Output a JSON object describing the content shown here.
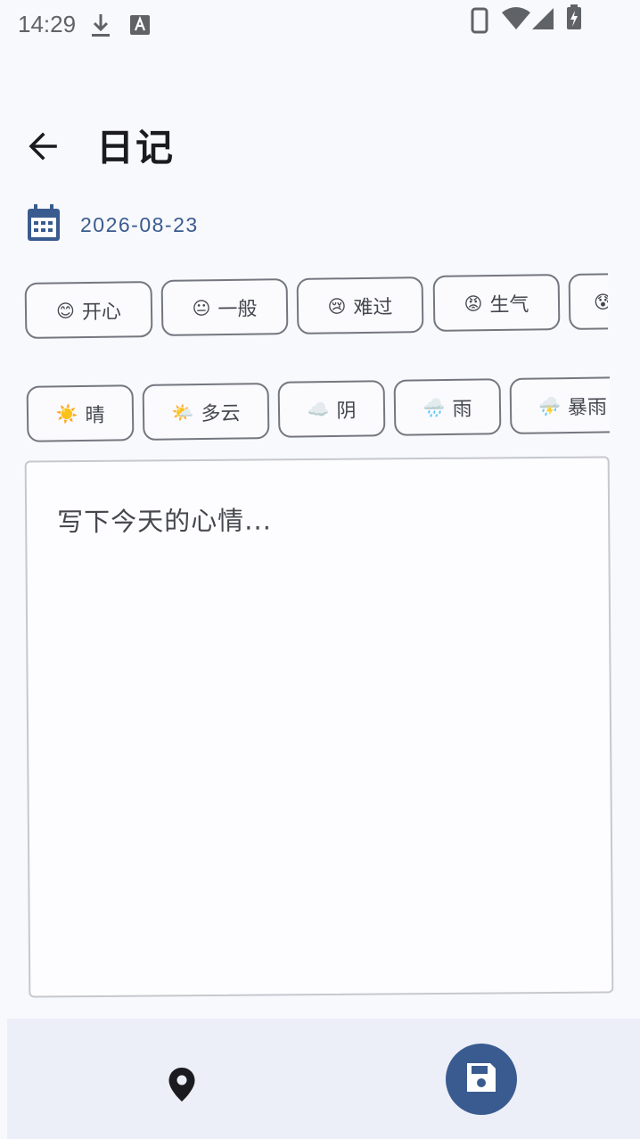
{
  "status_bar": {
    "time": "14:29",
    "icons": [
      "download-icon",
      "text-a-icon",
      "phone-icon",
      "wifi-icon",
      "signal-icon",
      "battery-charging-icon"
    ]
  },
  "app_bar": {
    "title": "日记",
    "back_icon": "arrow-left-icon"
  },
  "date_row": {
    "icon": "calendar-icon",
    "date": "2026-08-23"
  },
  "moods": [
    {
      "emoji": "😊",
      "label": "开心"
    },
    {
      "emoji": "😐",
      "label": "一般"
    },
    {
      "emoji": "😢",
      "label": "难过"
    },
    {
      "emoji": "😡",
      "label": "生气"
    },
    {
      "emoji": "😰",
      "label": ""
    }
  ],
  "weather": [
    {
      "emoji": "☀️",
      "label": "晴"
    },
    {
      "emoji": "🌤️",
      "label": "多云"
    },
    {
      "emoji": "☁️",
      "label": "阴"
    },
    {
      "emoji": "🌧️",
      "label": "雨"
    },
    {
      "emoji": "⛈️",
      "label": "暴雨"
    }
  ],
  "editor": {
    "placeholder": "写下今天的心情..."
  },
  "bottom_bar": {
    "location_icon": "location-pin-icon",
    "save_icon": "save-icon"
  },
  "colors": {
    "accent": "#3a5b8f",
    "background": "#f8f9fc",
    "bottom_bar": "#eceff8",
    "chip_border": "#74777f"
  }
}
